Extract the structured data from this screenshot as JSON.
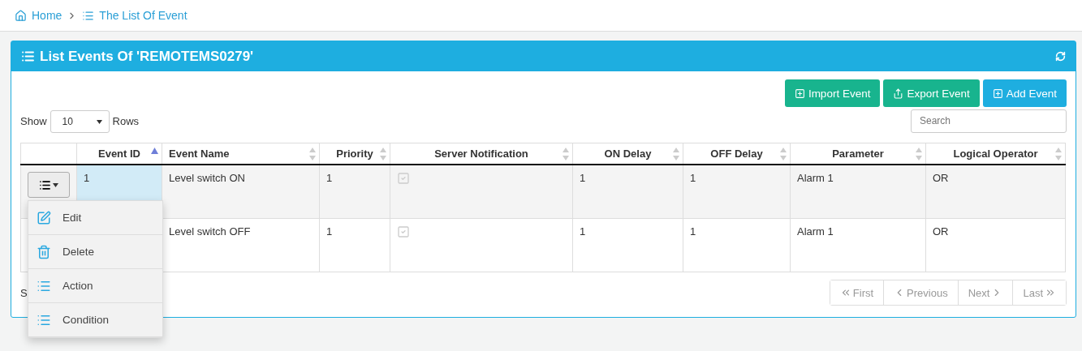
{
  "breadcrumb": [
    {
      "label": "Home",
      "kind": "home"
    },
    {
      "label": "The List Of Event",
      "kind": "list"
    }
  ],
  "panel": {
    "title": "List Events Of 'REMOTEMS0279'"
  },
  "toolbar_buttons": [
    {
      "label": "Import Event",
      "kind": "import"
    },
    {
      "label": "Export Event",
      "kind": "export"
    },
    {
      "label": "Add Event",
      "kind": "add"
    }
  ],
  "page_length": {
    "label_before": "Show",
    "value": "10",
    "label_after": "Rows"
  },
  "search": {
    "placeholder": "Search"
  },
  "table": {
    "columns": [
      {
        "label": "Event ID",
        "sorted": true
      },
      {
        "label": "Event Name",
        "sorted": false
      },
      {
        "label": "Priority",
        "sorted": false
      },
      {
        "label": "Server Notification",
        "sorted": false
      },
      {
        "label": "ON Delay",
        "sorted": false
      },
      {
        "label": "OFF Delay",
        "sorted": false
      },
      {
        "label": "Parameter",
        "sorted": false
      },
      {
        "label": "Logical Operator",
        "sorted": false
      }
    ],
    "rows": [
      {
        "menu_open": true,
        "id": "1",
        "name": "Level switch ON",
        "priority": "1",
        "server_notification": true,
        "on_delay": "1",
        "off_delay": "1",
        "parameter": "Alarm 1",
        "logical_operator": "OR"
      },
      {
        "menu_open": false,
        "name": "Level switch OFF",
        "priority": "1",
        "server_notification": true,
        "on_delay": "1",
        "off_delay": "1",
        "parameter": "Alarm 1",
        "logical_operator": "OR"
      }
    ]
  },
  "row_menu": [
    {
      "label": "Edit",
      "kind": "edit"
    },
    {
      "label": "Delete",
      "kind": "delete"
    },
    {
      "label": "Action",
      "kind": "list"
    },
    {
      "label": "Condition",
      "kind": "list"
    }
  ],
  "info": "S",
  "pagination": [
    {
      "label": "First",
      "kind": "first",
      "disabled": true
    },
    {
      "label": "Previous",
      "kind": "prev",
      "disabled": true
    },
    {
      "label": "Next",
      "kind": "next",
      "disabled": true
    },
    {
      "label": "Last",
      "kind": "last",
      "disabled": true
    }
  ]
}
